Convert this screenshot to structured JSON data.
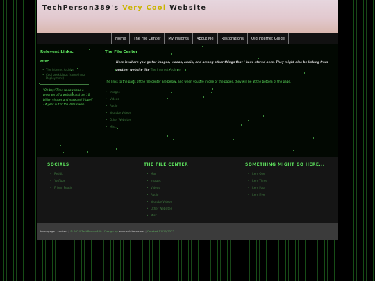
{
  "header": {
    "title_prefix": "TechPerson389's",
    "title_accent": "Very Cool",
    "title_suffix": "Website"
  },
  "nav": [
    "Home",
    "The File Center",
    "My Insights",
    "About Me",
    "Restorations",
    "Old Internet Guide"
  ],
  "sidebar": {
    "heading": "Relevent Links:",
    "subheading": "Misc.",
    "links": [
      "The internet Archive",
      "Cool geek blogs (something Deployment)"
    ],
    "quote": "\"Oh boy! Time to download a program off a website and get 10 billion viruses and malware! Yippe!\" - 4 year out of the 2000s web"
  },
  "main": {
    "title": "The File Center",
    "intro": "Here is where you go for images, videos, audio, and among other things that I have stored here. They might also be linking from another website like",
    "intro_link": "The Internet Archive.",
    "note": "The links to the parts of the file center are below, and when you are in one of the pages, they will be at the bottom of the page.",
    "links": [
      "Images",
      "Videos",
      "Audio",
      "Youtube Videos",
      "Other Websites",
      "Misc."
    ]
  },
  "footer_columns": [
    {
      "heading": "SOCIALS",
      "items": [
        "Reddit",
        "YouTube",
        "Friend Reads"
      ]
    },
    {
      "heading": "THE FILE CENTER",
      "items": [
        "Mac",
        "Images",
        "Videos",
        "Audio",
        "Youtube Videos",
        "Other Websites",
        "Misc."
      ]
    },
    {
      "heading": "SOMETHING MIGHT GO HERE...",
      "items": [
        "Item One",
        "Item Three",
        "Item Four",
        "Item Five"
      ]
    }
  ],
  "footer": {
    "homepage": "homepage",
    "contact": "contact",
    "copyright": "© 2024 TechPerson389",
    "design_prefix": "Design by",
    "design_link": "www.enlchmae.net",
    "created": "Created 11/19/2022"
  }
}
